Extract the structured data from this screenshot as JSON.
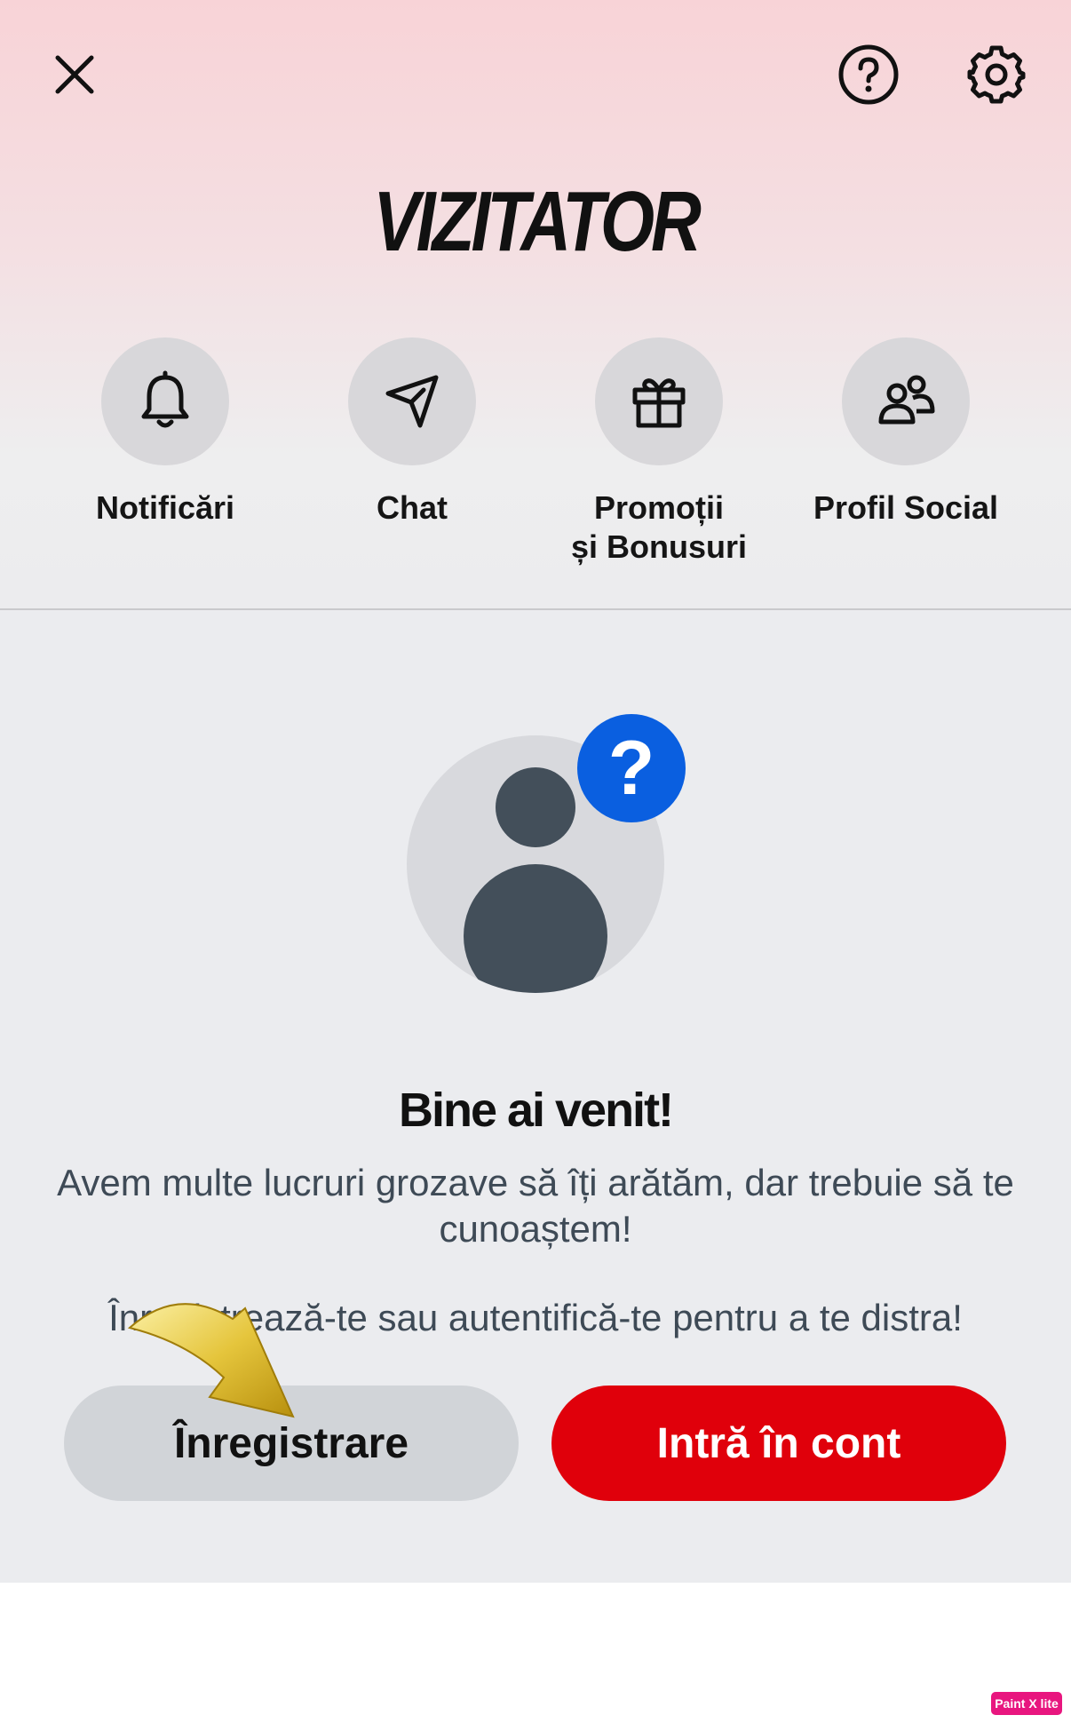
{
  "header": {
    "close_icon": "close-icon",
    "help_icon": "help-circle-icon",
    "settings_icon": "gear-icon",
    "title": "VIZITATOR"
  },
  "quick_actions": [
    {
      "icon": "bell-icon",
      "label": "Notificări"
    },
    {
      "icon": "send-icon",
      "label": "Chat"
    },
    {
      "icon": "gift-icon",
      "label": "Promoții\nși Bonusuri"
    },
    {
      "icon": "users-icon",
      "label": "Profil Social"
    }
  ],
  "welcome": {
    "avatar_icon": "user-avatar-icon",
    "badge_text": "?",
    "title": "Bine ai venit!",
    "text": "Avem multe lucruri grozave să îți arătăm, dar trebuie să te cunoaștem!",
    "subtext": "Înregistrează-te sau autentifică-te pentru a te distra!"
  },
  "buttons": {
    "register_label": "Înregistrare",
    "login_label": "Intră în cont"
  },
  "colors": {
    "accent_red": "#e0000b",
    "badge_blue": "#0a5fe0",
    "avatar_dark": "#434f5a"
  },
  "watermark": "Paint X lite"
}
